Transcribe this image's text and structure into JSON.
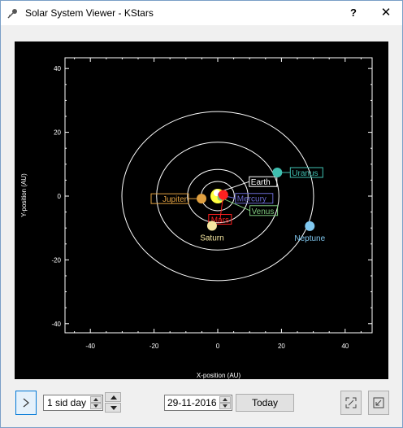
{
  "window": {
    "title": "Solar System Viewer - KStars",
    "help_label": "?",
    "close_label": "✕",
    "app_icon": "kstars-icon"
  },
  "plot": {
    "background": "#000000",
    "x_axis_title": "X-position (AU)",
    "y_axis_title": "Y-position (AU)",
    "x_ticks": [
      "-40",
      "-20",
      "0",
      "20",
      "40"
    ],
    "y_ticks": [
      "40",
      "20",
      "0",
      "-20",
      "-40"
    ],
    "planets": [
      {
        "name": "Earth",
        "color": "#ffffff"
      },
      {
        "name": "Mercury",
        "color": "#6a6ad0"
      },
      {
        "name": "Venus",
        "color": "#7ec87e"
      },
      {
        "name": "Mars",
        "color": "#ff2020"
      },
      {
        "name": "Jupiter",
        "color": "#e0a040"
      },
      {
        "name": "Saturn",
        "color": "#f5e6a0"
      },
      {
        "name": "Uranus",
        "color": "#3fbfb0"
      },
      {
        "name": "Neptune",
        "color": "#80c8f0"
      }
    ]
  },
  "chart_data": {
    "type": "scatter",
    "title": "",
    "xlabel": "X-position (AU)",
    "ylabel": "Y-position (AU)",
    "xlim": [
      -50,
      50
    ],
    "ylim": [
      -50,
      50
    ],
    "grid": false,
    "orbits_au": [
      0.4,
      0.7,
      1.0,
      1.5,
      5.2,
      9.5,
      19.2,
      30.1
    ],
    "points": [
      {
        "name": "Sun",
        "x": 0,
        "y": 0,
        "color": "#ffff40"
      },
      {
        "name": "Earth",
        "x": -0.3,
        "y": 0.95,
        "color": "#ffffff"
      },
      {
        "name": "Mercury",
        "x": 0.3,
        "y": 0.1,
        "color": "#6a6ad0"
      },
      {
        "name": "Venus",
        "x": 0.6,
        "y": -0.3,
        "color": "#7ec87e"
      },
      {
        "name": "Mars",
        "x": 1.4,
        "y": 0.3,
        "color": "#ff2020"
      },
      {
        "name": "Jupiter",
        "x": -5.1,
        "y": -0.8,
        "color": "#e0a040"
      },
      {
        "name": "Saturn",
        "x": -1.8,
        "y": -9.3,
        "color": "#f5e6a0"
      },
      {
        "name": "Uranus",
        "x": 18.7,
        "y": 7.4,
        "color": "#3fbfb0"
      },
      {
        "name": "Neptune",
        "x": 28.9,
        "y": -9.4,
        "color": "#80c8f0"
      }
    ]
  },
  "controls": {
    "time_step": "1 sid day",
    "date": "29-11-2016",
    "today_label": "Today",
    "play_icon": "play-icon",
    "zoom_in_icon": "zoom-in-icon",
    "zoom_out_icon": "zoom-out-icon"
  }
}
